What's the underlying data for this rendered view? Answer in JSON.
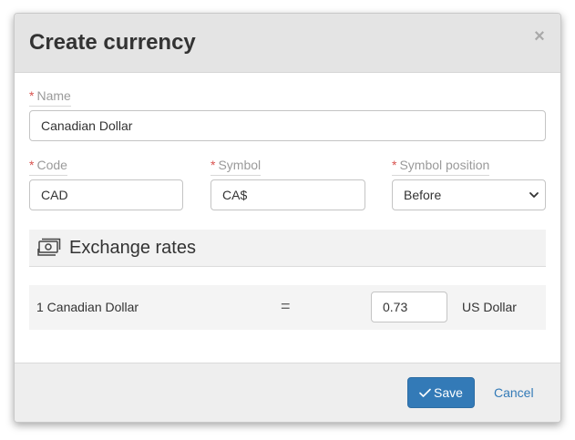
{
  "modal": {
    "title": "Create currency",
    "close_glyph": "×"
  },
  "form": {
    "name": {
      "label": "Name",
      "required_mark": "*",
      "value": "Canadian Dollar"
    },
    "code": {
      "label": "Code",
      "required_mark": "*",
      "value": "CAD"
    },
    "symbol": {
      "label": "Symbol",
      "required_mark": "*",
      "value": "CA$"
    },
    "symbol_position": {
      "label": "Symbol position",
      "required_mark": "*",
      "selected": "Before"
    }
  },
  "exchange_rates": {
    "section_title": "Exchange rates",
    "icon": "money-bill-icon",
    "rows": [
      {
        "from_text": "1 Canadian Dollar",
        "equals": "=",
        "rate": "0.73",
        "to_currency": "US Dollar"
      }
    ]
  },
  "footer": {
    "save_label": "Save",
    "cancel_label": "Cancel"
  },
  "colors": {
    "primary": "#337ab7",
    "required": "#d9534f",
    "header_bg": "#e4e4e4",
    "footer_bg": "#eeeeee"
  }
}
